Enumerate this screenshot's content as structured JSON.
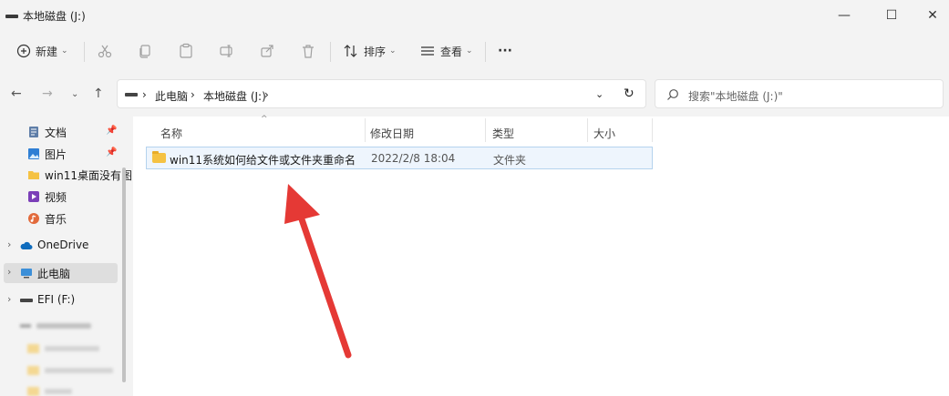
{
  "window": {
    "title": "本地磁盘 (J:)",
    "controls": [
      "—",
      "☐",
      "✕"
    ]
  },
  "toolbar": {
    "new_label": "新建",
    "sort_label": "排序",
    "view_label": "查看",
    "more_label": "···"
  },
  "address": {
    "crumbs": [
      "此电脑",
      "本地磁盘 (J:)"
    ],
    "search_placeholder": "搜索\"本地磁盘 (J:)\""
  },
  "sidebar": {
    "items": [
      {
        "label": "文档",
        "icon": "document-icon",
        "pinned": true
      },
      {
        "label": "图片",
        "icon": "picture-icon",
        "pinned": true
      },
      {
        "label": "win11桌面没有图",
        "icon": "folder-icon",
        "pinned": false
      },
      {
        "label": "视频",
        "icon": "video-icon",
        "pinned": false
      },
      {
        "label": "音乐",
        "icon": "music-icon",
        "pinned": false
      },
      {
        "label": "OneDrive",
        "icon": "cloud-icon",
        "pinned": false
      },
      {
        "label": "此电脑",
        "icon": "computer-icon",
        "pinned": false,
        "selected": true
      },
      {
        "label": "EFI (F:)",
        "icon": "drive-icon",
        "pinned": false
      }
    ]
  },
  "columns": {
    "name": "名称",
    "modified": "修改日期",
    "type": "类型",
    "size": "大小"
  },
  "files": [
    {
      "name": "win11系统如何给文件或文件夹重命名",
      "modified": "2022/2/8 18:04",
      "type": "文件夹",
      "size": ""
    }
  ],
  "colors": {
    "accent": "#0067c0",
    "selection_bg": "#eef5fd",
    "annotation_arrow": "#e53935",
    "folder": "#f5c243"
  }
}
